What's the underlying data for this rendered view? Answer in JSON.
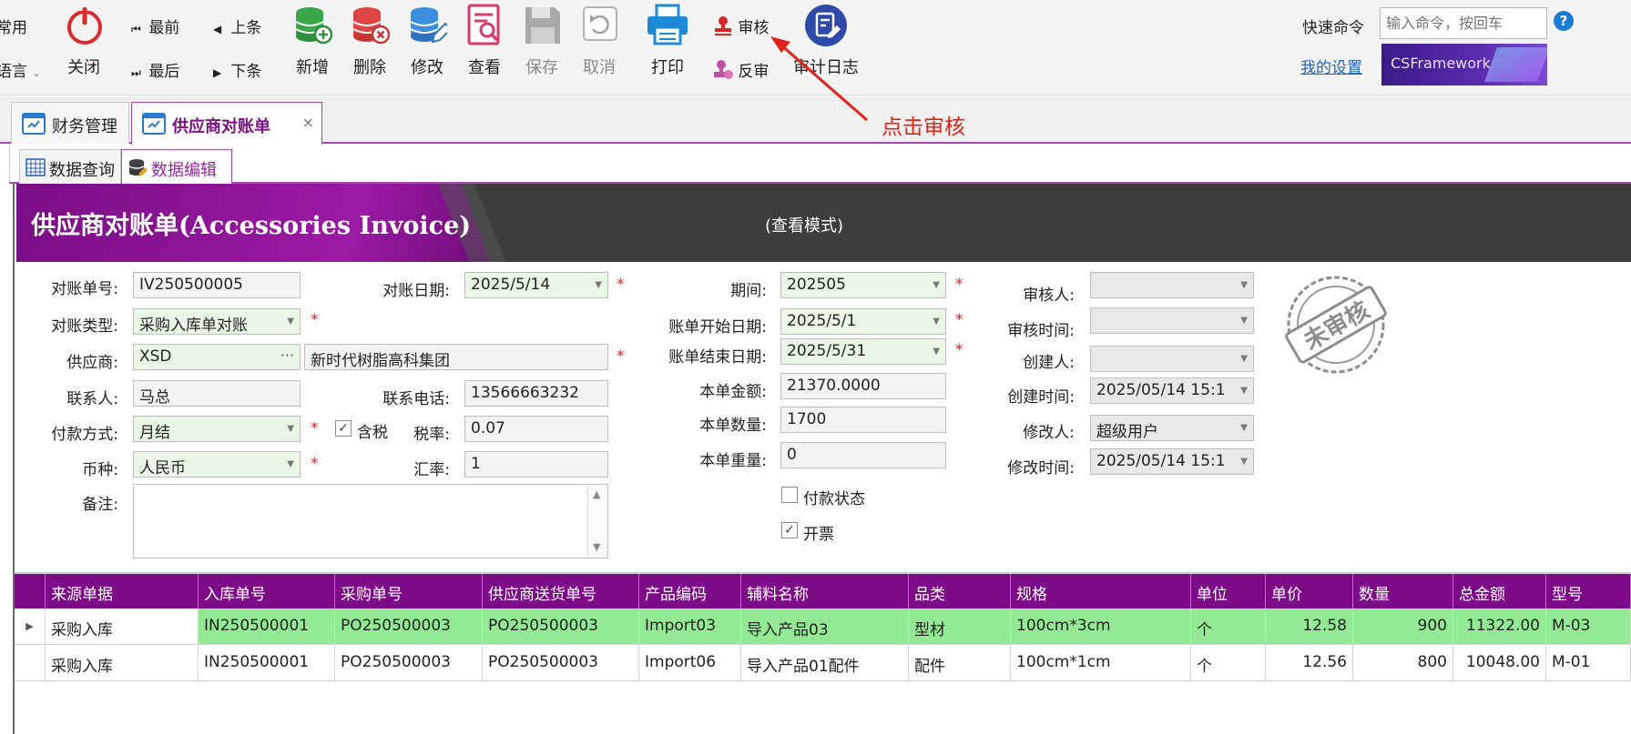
{
  "ribbon": {
    "left_top": "常用",
    "left_bottom": "语言",
    "close": "关闭",
    "first": "最前",
    "prev": "上条",
    "last": "最后",
    "next": "下条",
    "add": "新增",
    "delete": "删除",
    "edit": "修改",
    "view": "查看",
    "save": "保存",
    "cancel": "取消",
    "print": "打印",
    "approve": "审核",
    "unapprove": "反审",
    "audit_log": "审计日志",
    "quick_command_label": "快速命令",
    "quick_command_placeholder": "输入命令，按回车",
    "help": "?",
    "my_settings": "我的设置",
    "logo_text": "CSFramework"
  },
  "annotation": {
    "text": "点击审核",
    "color": "#e2231a"
  },
  "doc_tabs": [
    {
      "label": "财务管理"
    },
    {
      "label": "供应商对账单",
      "close": "×"
    }
  ],
  "sub_tabs": [
    {
      "label": "数据查询"
    },
    {
      "label": "数据编辑"
    }
  ],
  "form": {
    "title": "供应商对账单(Accessories Invoice)",
    "mode": "(查看模式)",
    "labels": {
      "invoice_no": "对账单号:",
      "invoice_type": "对账类型:",
      "supplier": "供应商:",
      "contact": "联系人:",
      "payment": "付款方式:",
      "currency": "币种:",
      "memo": "备注:",
      "invoice_date": "对账日期:",
      "phone": "联系电话:",
      "tax_rate": "税率:",
      "exchange_rate": "汇率:",
      "tax_included": "含税",
      "period": "期间:",
      "bill_start": "账单开始日期:",
      "bill_end": "账单结束日期:",
      "amount": "本单金额:",
      "qty": "本单数量:",
      "weight": "本单重量:",
      "paid_status": "付款状态",
      "invoiced": "开票",
      "approver": "审核人:",
      "approve_time": "审核时间:",
      "creator": "创建人:",
      "create_time": "创建时间:",
      "modifier": "修改人:",
      "modify_time": "修改时间:"
    },
    "values": {
      "invoice_no": "IV250500005",
      "invoice_type": "采购入库单对账",
      "supplier_code": "XSD",
      "supplier_name": "新时代树脂高科集团",
      "contact": "马总",
      "payment": "月结",
      "currency": "人民币",
      "invoice_date": "2025/5/14",
      "phone": "13566663232",
      "tax_rate": "0.07",
      "exchange_rate": "1",
      "period": "202505",
      "bill_start": "2025/5/1",
      "bill_end": "2025/5/31",
      "amount": "21370.0000",
      "qty": "1700",
      "weight": "0",
      "approver": "",
      "approve_time": "",
      "creator": "",
      "create_time": "2025/05/14 15:1",
      "modifier": "超级用户",
      "modify_time": "2025/05/14 15:1"
    },
    "checks": {
      "tax_included": true,
      "paid_status": false,
      "invoiced": true
    },
    "required_mark": "*",
    "stamp_text": "未审核"
  },
  "grid": {
    "columns": [
      "来源单据",
      "入库单号",
      "采购单号",
      "供应商送货单号",
      "产品编码",
      "辅料名称",
      "品类",
      "规格",
      "单位",
      "单价",
      "数量",
      "总金额",
      "型号"
    ],
    "rows": [
      [
        "采购入库",
        "IN250500001",
        "PO250500003",
        "PO250500003",
        "Import03",
        "导入产品03",
        "型材",
        "100cm*3cm",
        "个",
        "12.58",
        "900",
        "11322.00",
        "M-03"
      ],
      [
        "采购入库",
        "IN250500001",
        "PO250500003",
        "PO250500003",
        "Import06",
        "导入产品01配件",
        "配件",
        "100cm*1cm",
        "个",
        "12.56",
        "800",
        "10048.00",
        "M-01"
      ]
    ],
    "colors": {
      "header": "#7d0a86",
      "selected_row": "#94ea94"
    }
  },
  "colors": {
    "accent": "#a44aa8",
    "banner_purple": "#8a139a",
    "banner_dark": "#3d3d3d"
  }
}
